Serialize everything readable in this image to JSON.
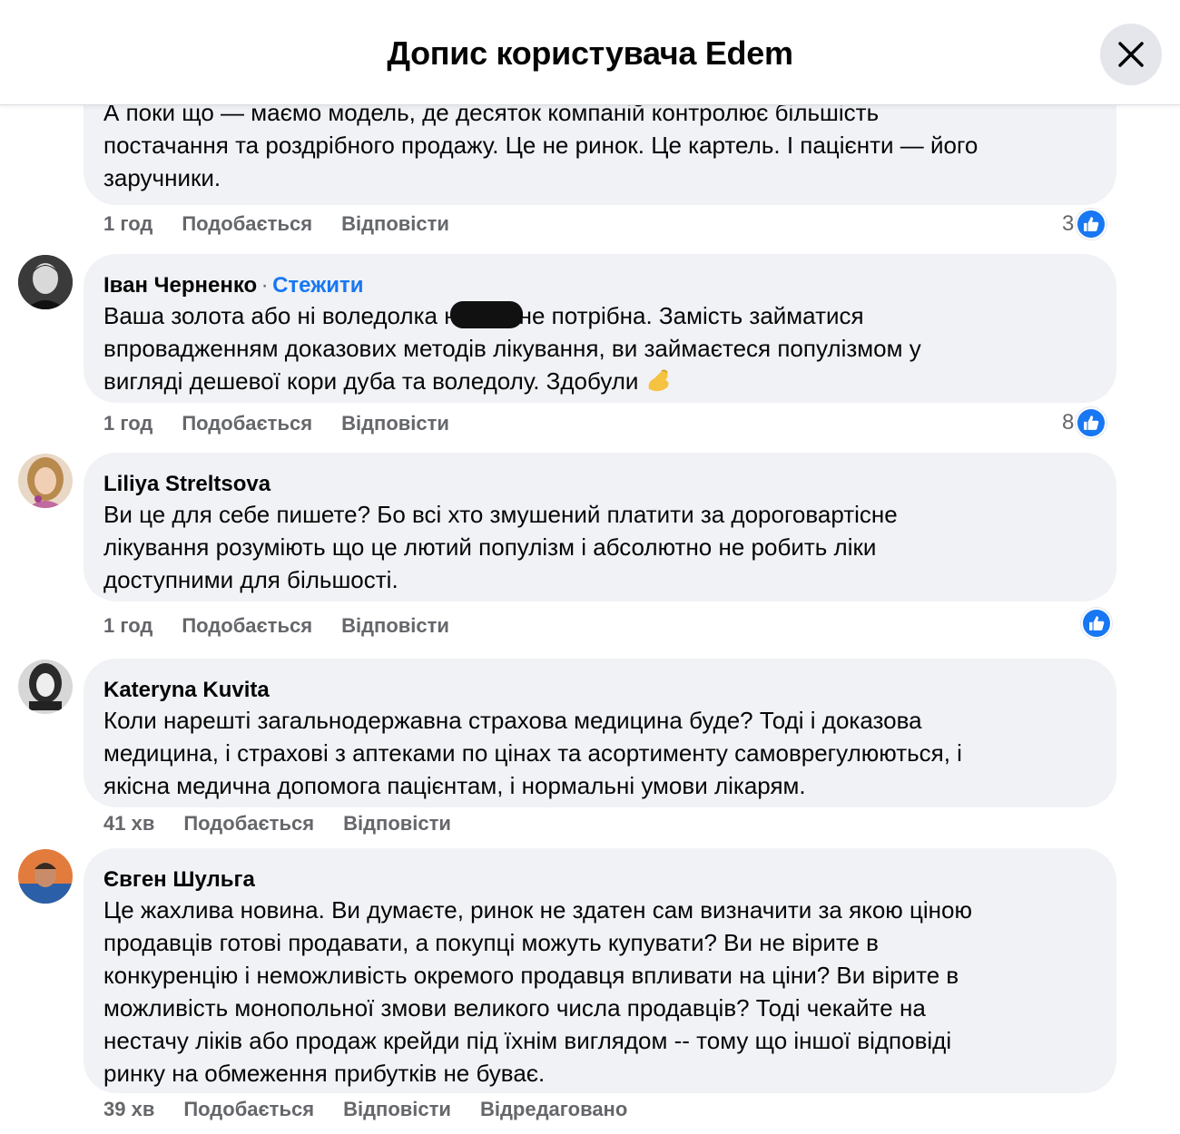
{
  "header": {
    "title": "Допис користувача Edem",
    "close_icon": "close-icon"
  },
  "comments": [
    {
      "text_lines": [
        "А поки що — маємо модель, де десяток компаній контролює більшість",
        "постачання та роздрібного продажу. Це не ринок. Це картель. І пацієнти — його",
        "заручники."
      ],
      "time": "1 год",
      "like_label": "Подобається",
      "reply_label": "Відповісти",
      "likes": "3"
    },
    {
      "author": "Іван Черненко",
      "follow_sep": "·",
      "follow_label": "Стежити",
      "text_line1_a": "Ваша золота або ні воледолка н",
      "text_line1_b": "не потрібна. Замість займатися",
      "text_line2": "впровадженням доказових методів лікування, ви займаєтеся популізмом у",
      "text_line3": "вигляді дешевої кори дуба та воледолу. Здобули",
      "emoji": "pinched-fingers-emoji",
      "time": "1 год",
      "like_label": "Подобається",
      "reply_label": "Відповісти",
      "likes": "8"
    },
    {
      "author": "Liliya Streltsova",
      "text_lines": [
        "Ви це для себе пишете? Бо всі хто змушений платити за дороговартісне",
        "лікування розуміють що це лютий популізм і абсолютно не робить ліки",
        "доступними для більшості."
      ],
      "time": "1 год",
      "like_label": "Подобається",
      "reply_label": "Відповісти"
    },
    {
      "author": "Kateryna Kuvita",
      "text_lines": [
        "Коли нарешті загальнодержавна страхова медицина буде? Тоді і доказова",
        "медицина, і страхові з аптеками по цінах та асортименту самоврегулюються, і",
        "якісна медична допомога пацієнтам, і нормальні умови лікарям."
      ],
      "time": "41 хв",
      "like_label": "Подобається",
      "reply_label": "Відповісти"
    },
    {
      "author": "Євген Шульга",
      "text_lines": [
        "Це жахлива новина. Ви думаєте, ринок не здатен сам визначити за якою ціною",
        "продавців готові продавати, а покупці можуть купувати? Ви не вірите в",
        "конкуренцію і неможливість окремого продавця впливати на ціни? Ви вірите в",
        "можливість монопольної змови великого числа продавців? Тоді чекайте на",
        "нестачу ліків або продаж крейди під їхнім виглядом -- тому що іншої відповіді",
        "ринку на обмеження прибутків не буває."
      ],
      "time": "39 хв",
      "like_label": "Подобається",
      "reply_label": "Відповісти",
      "edited_label": "Відредаговано"
    }
  ],
  "colors": {
    "accent": "#1877f2",
    "bubble": "#f0f2f5",
    "meta": "#65676b"
  }
}
